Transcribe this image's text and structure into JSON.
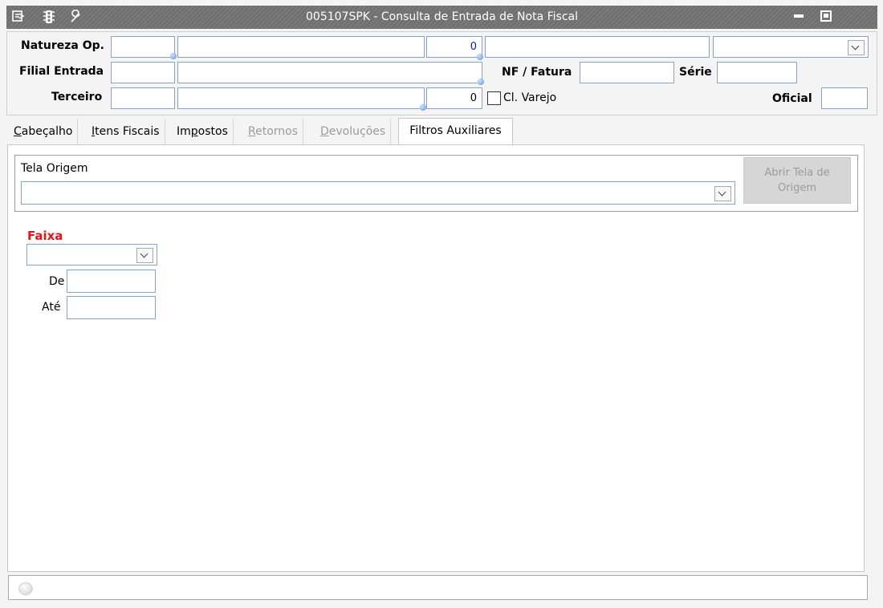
{
  "window": {
    "title": "005107SPK - Consulta de Entrada de Nota Fiscal",
    "icons": [
      "menu-icon",
      "traffic-light-icon",
      "wrench-icon",
      "minimize-icon",
      "restore-icon"
    ]
  },
  "header": {
    "natureza_label": "Natureza Op.",
    "natureza_value": "0",
    "filial_label": "Filial Entrada",
    "nf_label": "NF / Fatura",
    "serie_label": "Série",
    "terceiro_label": "Terceiro",
    "terceiro_value": "0",
    "varejo_label": "Cl. Varejo",
    "oficial_label": "Oficial"
  },
  "tabs": {
    "cabecalho": {
      "pre": "",
      "u": "C",
      "post": "abeçalho"
    },
    "itens": {
      "pre": "",
      "u": "I",
      "post": "tens Fiscais"
    },
    "impostos": {
      "pre": "Im",
      "u": "p",
      "post": "ostos"
    },
    "retornos": {
      "pre": "",
      "u": "R",
      "post": "etornos"
    },
    "devolucoes": {
      "pre": "",
      "u": "D",
      "post": "evoluções"
    },
    "filtros": "Filtros Auxiliares"
  },
  "filtros": {
    "tela_origem_label": "Tela Origem",
    "abrir_button": "Abrir Tela de Origem",
    "faixa_label": "Faixa",
    "de_label": "De",
    "ate_label": "Até"
  },
  "colors": {
    "title_bar": "#747474",
    "faixa_label": "#e0161b",
    "number_blue": "#1515d0"
  }
}
